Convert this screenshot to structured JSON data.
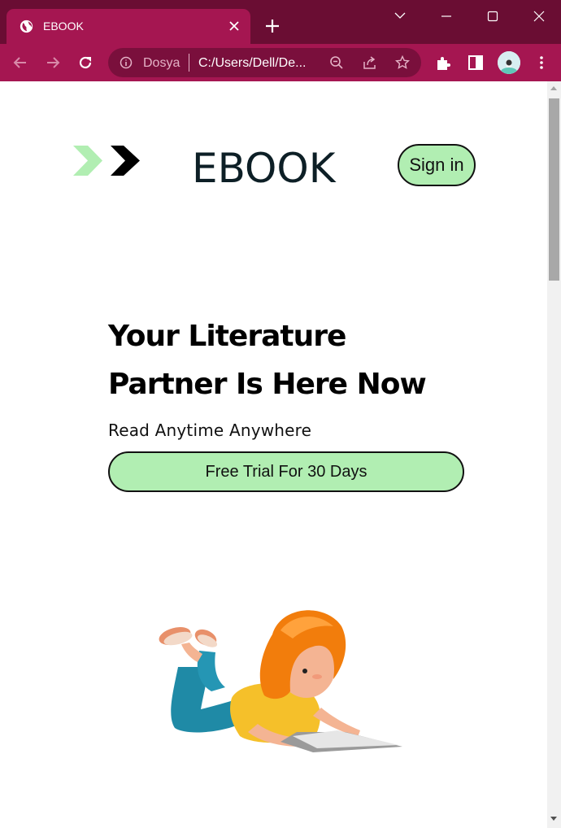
{
  "browser": {
    "tab_title": "EBOOK",
    "site_label": "Dosya",
    "url": "C:/Users/Dell/De..."
  },
  "page": {
    "brand": "EBOOK",
    "signin_label": "Sign in",
    "headline_line1": "Your Literature",
    "headline_line2": "Partner Is Here Now",
    "subline": "Read Anytime Anywhere",
    "trial_label": "Free Trial For 30 Days"
  },
  "colors": {
    "chrome_dark": "#6a0d33",
    "chrome_accent": "#a51651",
    "button_green": "#b1eeb2",
    "brand_text": "#0d1f26"
  }
}
